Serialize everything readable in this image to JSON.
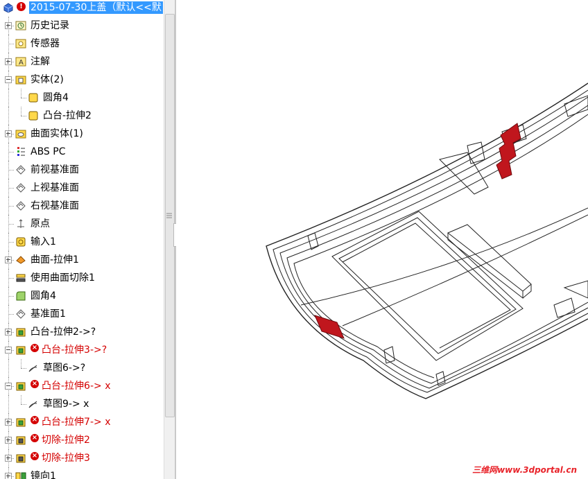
{
  "feature_tree": {
    "root_label": "2015-07-30上盖（默认<<默",
    "items": [
      {
        "label": "历史记录",
        "icon": "history-icon",
        "indent": 0,
        "expander": "plus",
        "error": false
      },
      {
        "label": "传感器",
        "icon": "sensor-icon",
        "indent": 0,
        "expander": "none",
        "error": false
      },
      {
        "label": "注解",
        "icon": "annotations-icon",
        "indent": 0,
        "expander": "plus",
        "error": false
      },
      {
        "label": "实体(2)",
        "icon": "solid-bodies-folder-icon",
        "indent": 0,
        "expander": "minus",
        "error": false
      },
      {
        "label": "圆角4",
        "icon": "solid-body-icon",
        "indent": 1,
        "expander": "none",
        "error": false
      },
      {
        "label": "凸台-拉伸2",
        "icon": "solid-body-icon",
        "indent": 1,
        "expander": "none",
        "error": false
      },
      {
        "label": "曲面实体(1)",
        "icon": "surface-bodies-folder-icon",
        "indent": 0,
        "expander": "plus",
        "error": false
      },
      {
        "label": "ABS PC",
        "icon": "material-icon",
        "indent": 0,
        "expander": "none",
        "error": false
      },
      {
        "label": "前视基准面",
        "icon": "plane-icon",
        "indent": 0,
        "expander": "none",
        "error": false
      },
      {
        "label": "上视基准面",
        "icon": "plane-icon",
        "indent": 0,
        "expander": "none",
        "error": false
      },
      {
        "label": "右视基准面",
        "icon": "plane-icon",
        "indent": 0,
        "expander": "none",
        "error": false
      },
      {
        "label": "原点",
        "icon": "origin-icon",
        "indent": 0,
        "expander": "none",
        "error": false
      },
      {
        "label": "输入1",
        "icon": "import-icon",
        "indent": 0,
        "expander": "none",
        "error": false
      },
      {
        "label": "曲面-拉伸1",
        "icon": "surface-extrude-icon",
        "indent": 0,
        "expander": "plus",
        "error": false
      },
      {
        "label": "使用曲面切除1",
        "icon": "surface-cut-icon",
        "indent": 0,
        "expander": "none",
        "error": false
      },
      {
        "label": "圆角4",
        "icon": "fillet-icon",
        "indent": 0,
        "expander": "none",
        "error": false
      },
      {
        "label": "基准面1",
        "icon": "plane-icon",
        "indent": 0,
        "expander": "none",
        "error": false
      },
      {
        "label": "凸台-拉伸2->?",
        "icon": "boss-extrude-icon",
        "indent": 0,
        "expander": "plus",
        "error": false
      },
      {
        "label": "凸台-拉伸3->?",
        "icon": "boss-extrude-icon",
        "indent": 0,
        "expander": "minus",
        "error": true
      },
      {
        "label": "草图6->?",
        "icon": "sketch-icon",
        "indent": 1,
        "expander": "none",
        "error": false
      },
      {
        "label": "凸台-拉伸6-> x",
        "icon": "boss-extrude-icon",
        "indent": 0,
        "expander": "minus",
        "error": true
      },
      {
        "label": "草图9-> x",
        "icon": "sketch-icon",
        "indent": 1,
        "expander": "none",
        "error": false
      },
      {
        "label": "凸台-拉伸7-> x",
        "icon": "boss-extrude-icon",
        "indent": 0,
        "expander": "plus",
        "error": true
      },
      {
        "label": "切除-拉伸2",
        "icon": "cut-extrude-icon",
        "indent": 0,
        "expander": "plus",
        "error": true
      },
      {
        "label": "切除-拉伸3",
        "icon": "cut-extrude-icon",
        "indent": 0,
        "expander": "plus",
        "error": true
      },
      {
        "label": "镜向1",
        "icon": "mirror-icon",
        "indent": 0,
        "expander": "plus",
        "error": false
      }
    ]
  },
  "watermark": "三维网www.3dportal.cn",
  "colors": {
    "selection": "#3399ff",
    "error_text": "#d40000",
    "model_highlight": "#c0161d"
  }
}
